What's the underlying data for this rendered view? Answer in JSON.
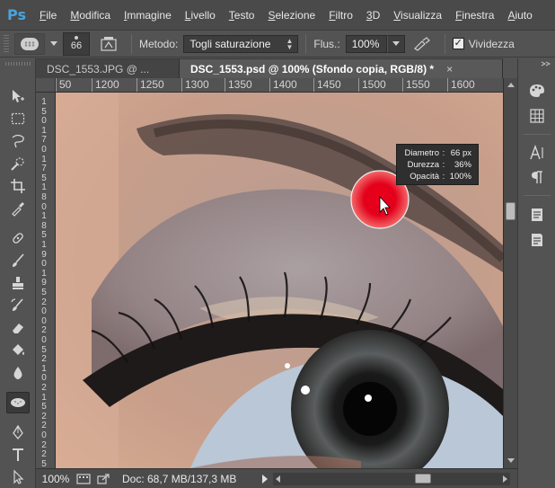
{
  "menu": {
    "logo": "Ps",
    "items": [
      "File",
      "Modifica",
      "Immagine",
      "Livello",
      "Testo",
      "Selezione",
      "Filtro",
      "3D",
      "Visualizza",
      "Finestra",
      "Aiuto"
    ]
  },
  "options": {
    "brush_size": "66",
    "method_label": "Metodo:",
    "method_value": "Togli saturazione",
    "flow_label": "Flus.:",
    "flow_value": "100%",
    "vibrance_label": "Vividezza",
    "vibrance_checked": true
  },
  "tabs": [
    {
      "label": "DSC_1553.JPG @ ...",
      "active": false
    },
    {
      "label": "DSC_1553.psd @ 100% (Sfondo copia, RGB/8) *",
      "active": true
    }
  ],
  "ruler": {
    "h_labels": [
      "50",
      "1200",
      "1250",
      "1300",
      "1350",
      "1400",
      "1450",
      "1500",
      "1550",
      "1600"
    ],
    "v_labels": [
      "1",
      "5",
      "0",
      "1",
      "7",
      "0",
      "1",
      "7",
      "5",
      "1",
      "8",
      "0",
      "1",
      "8",
      "5",
      "1",
      "9",
      "0",
      "1",
      "9",
      "5",
      "2",
      "0",
      "0",
      "2",
      "0",
      "5",
      "2",
      "1",
      "0",
      "2",
      "1",
      "5",
      "2",
      "2",
      "0",
      "2",
      "2",
      "5"
    ]
  },
  "tooltip": {
    "rows": [
      {
        "key": "Diametro",
        "value": "66 px"
      },
      {
        "key": "Durezza",
        "value": "36%"
      },
      {
        "key": "Opacità",
        "value": "100%"
      }
    ]
  },
  "status": {
    "zoom": "100%",
    "doc": "Doc: 68,7 MB/137,3 MB"
  },
  "tools": [
    "move-tool-icon",
    "marquee-tool-icon",
    "lasso-tool-icon",
    "quick-selection-tool-icon",
    "crop-tool-icon",
    "eyedropper-tool-icon",
    "spot-healing-tool-icon",
    "brush-tool-icon",
    "clone-stamp-tool-icon",
    "history-brush-tool-icon",
    "eraser-tool-icon",
    "paint-bucket-tool-icon",
    "blur-tool-icon",
    "sponge-tool-icon",
    "pen-tool-icon",
    "type-tool-icon",
    "path-selection-tool-icon"
  ],
  "colors": {
    "ui_dark": "#535353",
    "menu_bg": "#4a4a4a",
    "accent_ps": "#4aa3df",
    "brush_red": "#e3001b"
  }
}
